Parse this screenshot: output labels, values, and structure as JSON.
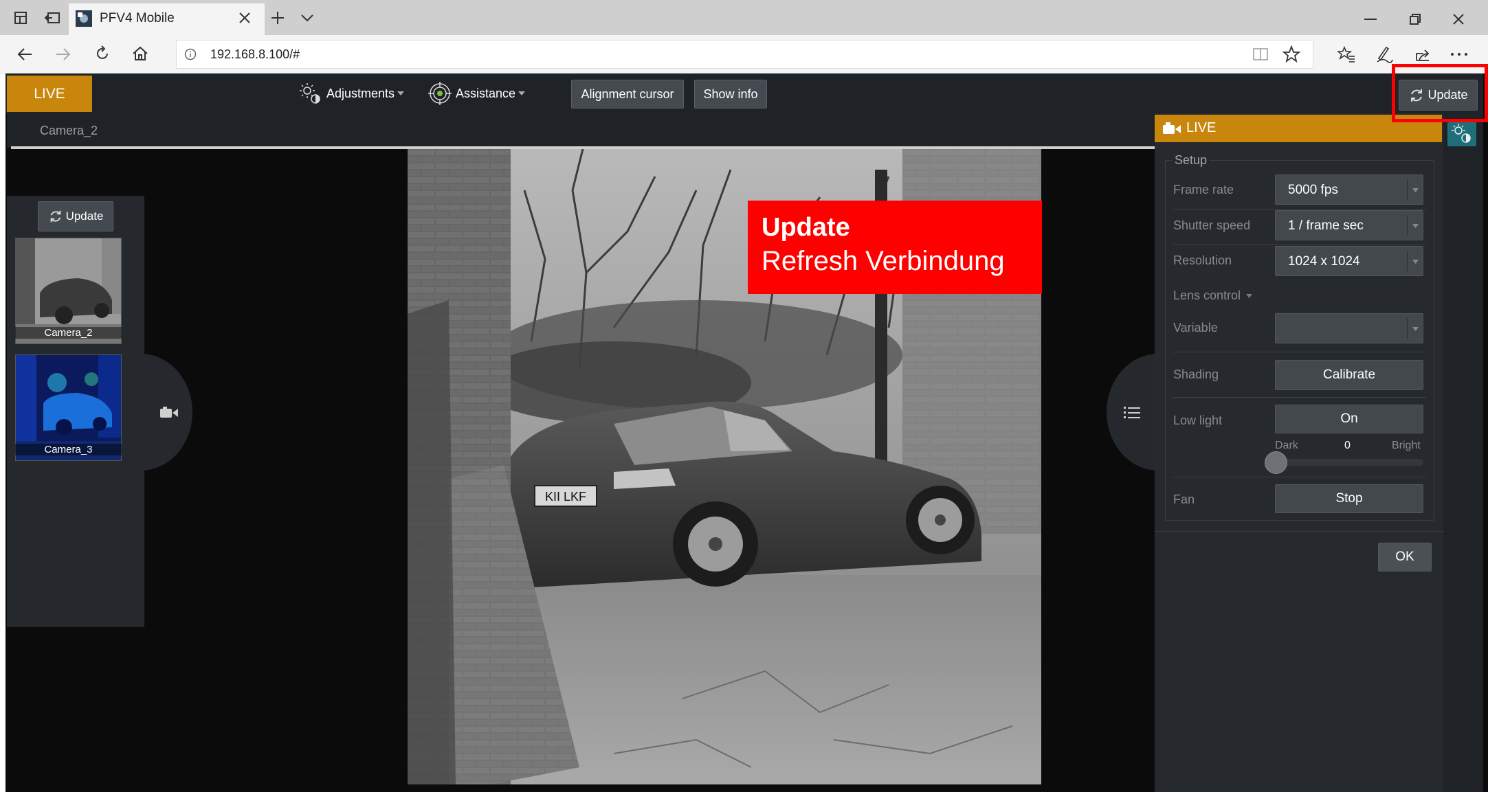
{
  "browser": {
    "tab_title": "PFV4 Mobile",
    "url": "192.168.8.100/#"
  },
  "topbar": {
    "live_label": "LIVE",
    "adjustments_label": "Adjustments",
    "assistance_label": "Assistance",
    "alignment_cursor_label": "Alignment cursor",
    "show_info_label": "Show info",
    "update_label": "Update"
  },
  "camera_view": {
    "title": "Camera_2"
  },
  "camera_list": {
    "update_label": "Update",
    "cameras": [
      {
        "name": "Camera_2"
      },
      {
        "name": "Camera_3"
      }
    ]
  },
  "annotation": {
    "title": "Update",
    "subtitle": "Refresh Verbindung",
    "color": "#ff0000"
  },
  "settings_panel": {
    "header": "LIVE",
    "section": "Setup",
    "frame_rate_label": "Frame rate",
    "frame_rate_value": "5000 fps",
    "shutter_label": "Shutter speed",
    "shutter_value": "1 / frame sec",
    "resolution_label": "Resolution",
    "resolution_value": "1024 x 1024",
    "lens_control_label": "Lens control",
    "variable_label": "Variable",
    "variable_value": "",
    "shading_label": "Shading",
    "calibrate_label": "Calibrate",
    "low_light_label": "Low light",
    "low_light_value": "On",
    "dark_label": "Dark",
    "bright_label": "Bright",
    "light_level": "0",
    "fan_label": "Fan",
    "fan_value": "Stop",
    "ok_label": "OK"
  },
  "colors": {
    "accent": "#c8860d",
    "panel": "#26292d",
    "highlight": "#ff0000"
  }
}
